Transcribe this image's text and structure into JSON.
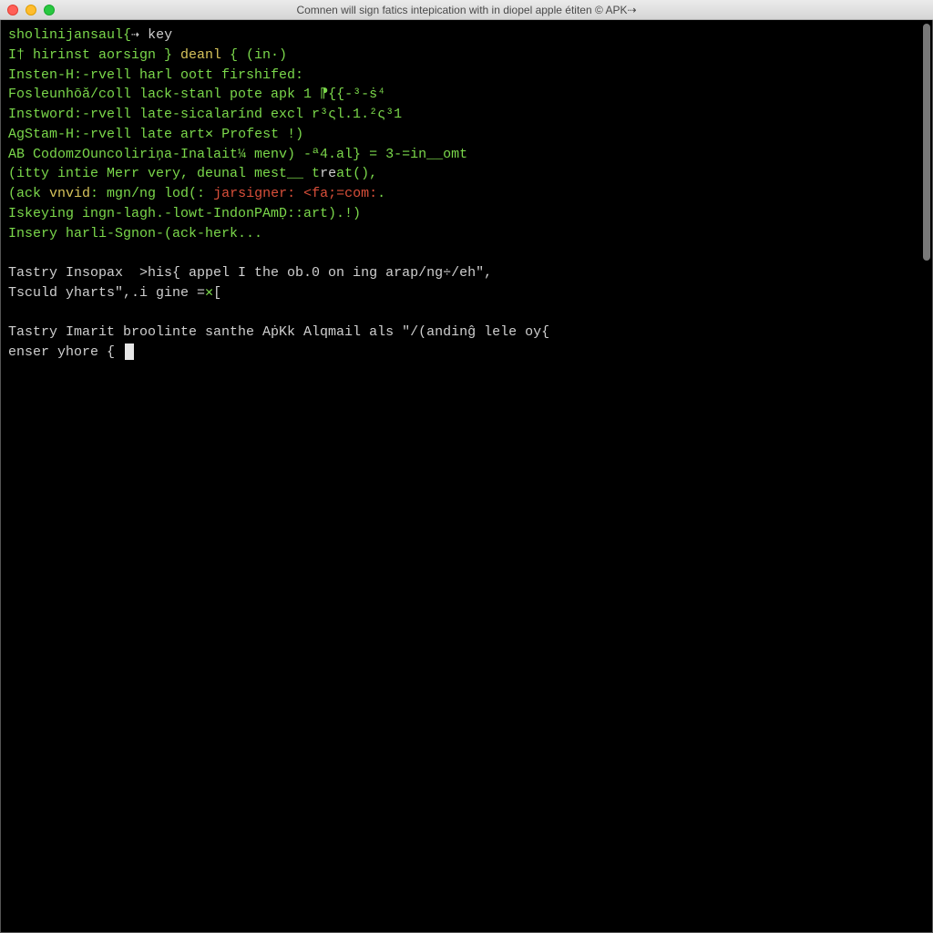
{
  "window": {
    "title": "Comnen will sign fatics intepication with in diopel apple étiten © APK⇢"
  },
  "terminal": {
    "lines": [
      {
        "segs": [
          {
            "c": "g",
            "t": "sholinijansaul{"
          },
          {
            "c": "w",
            "t": "⇢ key"
          }
        ]
      },
      {
        "segs": [
          {
            "c": "g",
            "t": "I† hirinst aorsign } "
          },
          {
            "c": "y",
            "t": "deanl"
          },
          {
            "c": "g",
            "t": " { (in·)"
          }
        ]
      },
      {
        "segs": [
          {
            "c": "g",
            "t": "Insten-H:-rvell harl oott firshifed:"
          }
        ]
      },
      {
        "segs": [
          {
            "c": "g",
            "t": "Fosleunhōǎ/coll lack-stanl pote apk 1 ⁋{{-³-ṡ⁴"
          }
        ]
      },
      {
        "segs": [
          {
            "c": "g",
            "t": "Instword:-rvell late-sicalarínd excl r³ςl.1.²ς³1"
          }
        ]
      },
      {
        "segs": [
          {
            "c": "g",
            "t": "AgStam-H:-rvell late art✕ Profest !)"
          }
        ]
      },
      {
        "segs": [
          {
            "c": "g",
            "t": "AB CodomzOuncoliriņa-Inalait¼ menv) -ª4.al} = 3-=in__omt"
          }
        ]
      },
      {
        "segs": [
          {
            "c": "g",
            "t": "(itty intie Merr very, deunal mest__ t"
          },
          {
            "c": "w",
            "t": "re"
          },
          {
            "c": "g",
            "t": "at(),"
          }
        ]
      },
      {
        "segs": [
          {
            "c": "g",
            "t": "(ack "
          },
          {
            "c": "y",
            "t": "vnvid"
          },
          {
            "c": "g",
            "t": ": mgn/ng lod(: "
          },
          {
            "c": "r",
            "t": "jarsigner: <fa;=com:"
          },
          {
            "c": "g",
            "t": "."
          }
        ]
      },
      {
        "segs": [
          {
            "c": "g",
            "t": "Iskeying ingn-lagh.-lowt-IndonPAmḌ::art).!)"
          }
        ]
      },
      {
        "segs": [
          {
            "c": "g",
            "t": "Insery harli-Sgnon-(ack-herk..."
          }
        ]
      },
      {
        "blank": true
      },
      {
        "segs": [
          {
            "c": "w",
            "t": "Tastry Insopax  >his{ appel I the ob.0 on ing arap/ng÷/eh\","
          }
        ]
      },
      {
        "segs": [
          {
            "c": "w",
            "t": "Tsculd yharts\",.i gine ="
          },
          {
            "c": "g",
            "t": "✕"
          },
          {
            "c": "w",
            "t": "["
          }
        ]
      },
      {
        "blank": true
      },
      {
        "segs": [
          {
            "c": "w",
            "t": "Tastry Imarit broolinte santhe AṗKk Alqmail als \"/(andinĝ lele oy{"
          }
        ]
      },
      {
        "segs": [
          {
            "c": "w",
            "t": "enser yhore { "
          }
        ],
        "cursor": true
      }
    ]
  }
}
